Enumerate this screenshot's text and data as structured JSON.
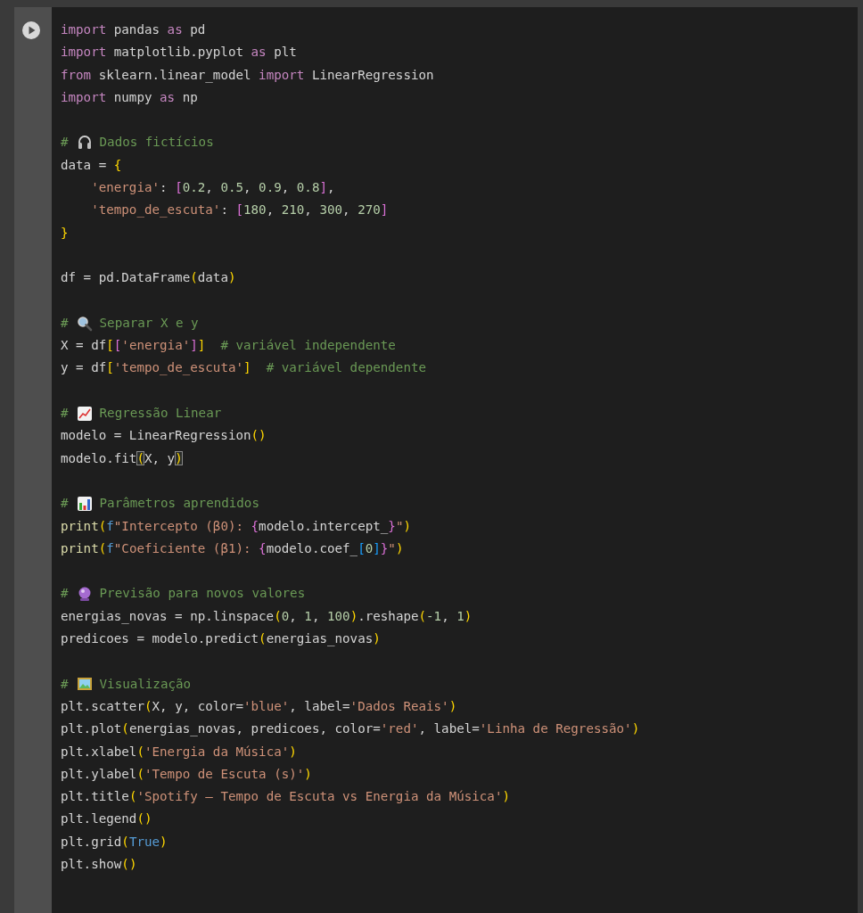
{
  "cell": {
    "blocks": [
      {
        "lines": [
          [
            {
              "kind": "kw",
              "text": "import"
            },
            {
              "kind": "plain",
              "text": " pandas "
            },
            {
              "kind": "kw",
              "text": "as"
            },
            {
              "kind": "plain",
              "text": " pd"
            }
          ],
          [
            {
              "kind": "kw",
              "text": "import"
            },
            {
              "kind": "plain",
              "text": " matplotlib.pyplot "
            },
            {
              "kind": "kw",
              "text": "as"
            },
            {
              "kind": "plain",
              "text": " plt"
            }
          ],
          [
            {
              "kind": "kw",
              "text": "from"
            },
            {
              "kind": "plain",
              "text": " sklearn.linear_model "
            },
            {
              "kind": "kw",
              "text": "import"
            },
            {
              "kind": "plain",
              "text": " LinearRegression"
            }
          ],
          [
            {
              "kind": "kw",
              "text": "import"
            },
            {
              "kind": "plain",
              "text": " numpy "
            },
            {
              "kind": "kw",
              "text": "as"
            },
            {
              "kind": "plain",
              "text": " np"
            }
          ]
        ]
      },
      {
        "lines": [
          [
            {
              "kind": "com",
              "text": "#"
            },
            {
              "kind": "icon"
            },
            {
              "kind": "com",
              "text": "Dados fictícios"
            }
          ],
          [
            {
              "kind": "plain",
              "text": "data = "
            },
            {
              "kind": "b1",
              "text": "{"
            }
          ],
          [
            {
              "kind": "indent"
            },
            {
              "kind": "str",
              "text": "'energia'"
            },
            {
              "kind": "plain",
              "text": ": "
            },
            {
              "kind": "b2",
              "text": "["
            },
            {
              "kind": "num",
              "text": "0.2"
            },
            {
              "kind": "plain",
              "text": ", "
            },
            {
              "kind": "num",
              "text": "0.5"
            },
            {
              "kind": "plain",
              "text": ", "
            },
            {
              "kind": "num",
              "text": "0.9"
            },
            {
              "kind": "plain",
              "text": ", "
            },
            {
              "kind": "num",
              "text": "0.8"
            },
            {
              "kind": "b2",
              "text": "]"
            },
            {
              "kind": "plain",
              "text": ","
            }
          ],
          [
            {
              "kind": "indent"
            },
            {
              "kind": "str",
              "text": "'tempo_de_escuta'"
            },
            {
              "kind": "plain",
              "text": ": "
            },
            {
              "kind": "b2",
              "text": "["
            },
            {
              "kind": "num",
              "text": "180"
            },
            {
              "kind": "plain",
              "text": ", "
            },
            {
              "kind": "num",
              "text": "210"
            },
            {
              "kind": "plain",
              "text": ", "
            },
            {
              "kind": "num",
              "text": "300"
            },
            {
              "kind": "plain",
              "text": ", "
            },
            {
              "kind": "num",
              "text": "270"
            },
            {
              "kind": "b2",
              "text": "]"
            }
          ],
          [
            {
              "kind": "b1",
              "text": "}"
            }
          ]
        ]
      },
      {
        "lines": [
          [
            {
              "kind": "plain",
              "text": "df = pd.DataFrame"
            },
            {
              "kind": "b1",
              "text": "("
            },
            {
              "kind": "plain",
              "text": "data"
            },
            {
              "kind": "b1",
              "text": ")"
            }
          ]
        ]
      },
      {
        "lines": [
          [
            {
              "kind": "com",
              "text": "#"
            },
            {
              "kind": "icon"
            },
            {
              "kind": "com",
              "text": "Separar X e y"
            }
          ],
          [
            {
              "kind": "plain",
              "text": "X = df"
            },
            {
              "kind": "b1",
              "text": "["
            },
            {
              "kind": "b2",
              "text": "["
            },
            {
              "kind": "str",
              "text": "'energia'"
            },
            {
              "kind": "b2",
              "text": "]"
            },
            {
              "kind": "b1",
              "text": "]"
            },
            {
              "kind": "gap"
            },
            {
              "kind": "com",
              "text": "# variável independente"
            }
          ],
          [
            {
              "kind": "plain",
              "text": "y = df"
            },
            {
              "kind": "b1",
              "text": "["
            },
            {
              "kind": "str",
              "text": "'tempo_de_escuta'"
            },
            {
              "kind": "b1",
              "text": "]"
            },
            {
              "kind": "gap"
            },
            {
              "kind": "com",
              "text": "# variável dependente"
            }
          ]
        ]
      },
      {
        "lines": [
          [
            {
              "kind": "com",
              "text": "#"
            },
            {
              "kind": "icon"
            },
            {
              "kind": "com",
              "text": "Regressão Linear"
            }
          ],
          [
            {
              "kind": "plain",
              "text": "modelo = LinearRegression"
            },
            {
              "kind": "b1",
              "text": "()"
            }
          ],
          [
            {
              "kind": "plain",
              "text": "modelo.fit"
            },
            {
              "kind": "b1",
              "text": "(",
              "matched": true
            },
            {
              "kind": "plain",
              "text": "X, y"
            },
            {
              "kind": "b1",
              "text": ")",
              "matched": true
            }
          ]
        ]
      },
      {
        "lines": [
          [
            {
              "kind": "com",
              "text": "#"
            },
            {
              "kind": "icon"
            },
            {
              "kind": "com",
              "text": "Parâmetros aprendidos"
            }
          ],
          [
            {
              "kind": "fn",
              "text": "print"
            },
            {
              "kind": "b1",
              "text": "("
            },
            {
              "kind": "const",
              "text": "f"
            },
            {
              "kind": "str",
              "text": "\"Intercepto (β0): "
            },
            {
              "kind": "b2",
              "text": "{"
            },
            {
              "kind": "plain",
              "text": "modelo.intercept_"
            },
            {
              "kind": "b2",
              "text": "}"
            },
            {
              "kind": "str",
              "text": "\""
            },
            {
              "kind": "b1",
              "text": ")"
            }
          ],
          [
            {
              "kind": "fn",
              "text": "print"
            },
            {
              "kind": "b1",
              "text": "("
            },
            {
              "kind": "const",
              "text": "f"
            },
            {
              "kind": "str",
              "text": "\"Coeficiente (β1): "
            },
            {
              "kind": "b2",
              "text": "{"
            },
            {
              "kind": "plain",
              "text": "modelo.coef_"
            },
            {
              "kind": "b3",
              "text": "["
            },
            {
              "kind": "num",
              "text": "0"
            },
            {
              "kind": "b3",
              "text": "]"
            },
            {
              "kind": "b2",
              "text": "}"
            },
            {
              "kind": "str",
              "text": "\""
            },
            {
              "kind": "b1",
              "text": ")"
            }
          ]
        ]
      },
      {
        "lines": [
          [
            {
              "kind": "com",
              "text": "#"
            },
            {
              "kind": "icon"
            },
            {
              "kind": "com",
              "text": "Previsão para novos valores"
            }
          ],
          [
            {
              "kind": "plain",
              "text": "energias_novas = np.linspace"
            },
            {
              "kind": "b1",
              "text": "("
            },
            {
              "kind": "num",
              "text": "0"
            },
            {
              "kind": "plain",
              "text": ", "
            },
            {
              "kind": "num",
              "text": "1"
            },
            {
              "kind": "plain",
              "text": ", "
            },
            {
              "kind": "num",
              "text": "100"
            },
            {
              "kind": "b1",
              "text": ")"
            },
            {
              "kind": "plain",
              "text": ".reshape"
            },
            {
              "kind": "b1",
              "text": "("
            },
            {
              "kind": "num",
              "text": "-1"
            },
            {
              "kind": "plain",
              "text": ", "
            },
            {
              "kind": "num",
              "text": "1"
            },
            {
              "kind": "b1",
              "text": ")"
            }
          ],
          [
            {
              "kind": "plain",
              "text": "predicoes = modelo.predict"
            },
            {
              "kind": "b1",
              "text": "("
            },
            {
              "kind": "plain",
              "text": "energias_novas"
            },
            {
              "kind": "b1",
              "text": ")"
            }
          ]
        ]
      },
      {
        "lines": [
          [
            {
              "kind": "com",
              "text": "#"
            },
            {
              "kind": "icon"
            },
            {
              "kind": "com",
              "text": "Visualização"
            }
          ],
          [
            {
              "kind": "plain",
              "text": "plt.scatter"
            },
            {
              "kind": "b1",
              "text": "("
            },
            {
              "kind": "plain",
              "text": "X, y, color="
            },
            {
              "kind": "str",
              "text": "'blue'"
            },
            {
              "kind": "plain",
              "text": ", label="
            },
            {
              "kind": "str",
              "text": "'Dados Reais'"
            },
            {
              "kind": "b1",
              "text": ")"
            }
          ],
          [
            {
              "kind": "plain",
              "text": "plt.plot"
            },
            {
              "kind": "b1",
              "text": "("
            },
            {
              "kind": "plain",
              "text": "energias_novas, predicoes, color="
            },
            {
              "kind": "str",
              "text": "'red'"
            },
            {
              "kind": "plain",
              "text": ", label="
            },
            {
              "kind": "str",
              "text": "'Linha de Regressão'"
            },
            {
              "kind": "b1",
              "text": ")"
            }
          ],
          [
            {
              "kind": "plain",
              "text": "plt.xlabel"
            },
            {
              "kind": "b1",
              "text": "("
            },
            {
              "kind": "str",
              "text": "'Energia da Música'"
            },
            {
              "kind": "b1",
              "text": ")"
            }
          ],
          [
            {
              "kind": "plain",
              "text": "plt.ylabel"
            },
            {
              "kind": "b1",
              "text": "("
            },
            {
              "kind": "str",
              "text": "'Tempo de Escuta (s)'"
            },
            {
              "kind": "b1",
              "text": ")"
            }
          ],
          [
            {
              "kind": "plain",
              "text": "plt.title"
            },
            {
              "kind": "b1",
              "text": "("
            },
            {
              "kind": "str",
              "text": "'Spotify – Tempo de Escuta vs Energia da Música'"
            },
            {
              "kind": "b1",
              "text": ")"
            }
          ],
          [
            {
              "kind": "plain",
              "text": "plt.legend"
            },
            {
              "kind": "b1",
              "text": "()"
            }
          ],
          [
            {
              "kind": "plain",
              "text": "plt.grid"
            },
            {
              "kind": "b1",
              "text": "("
            },
            {
              "kind": "const",
              "text": "True"
            },
            {
              "kind": "b1",
              "text": ")"
            }
          ],
          [
            {
              "kind": "plain",
              "text": "plt.show"
            },
            {
              "kind": "b1",
              "text": "()"
            }
          ]
        ]
      }
    ]
  }
}
